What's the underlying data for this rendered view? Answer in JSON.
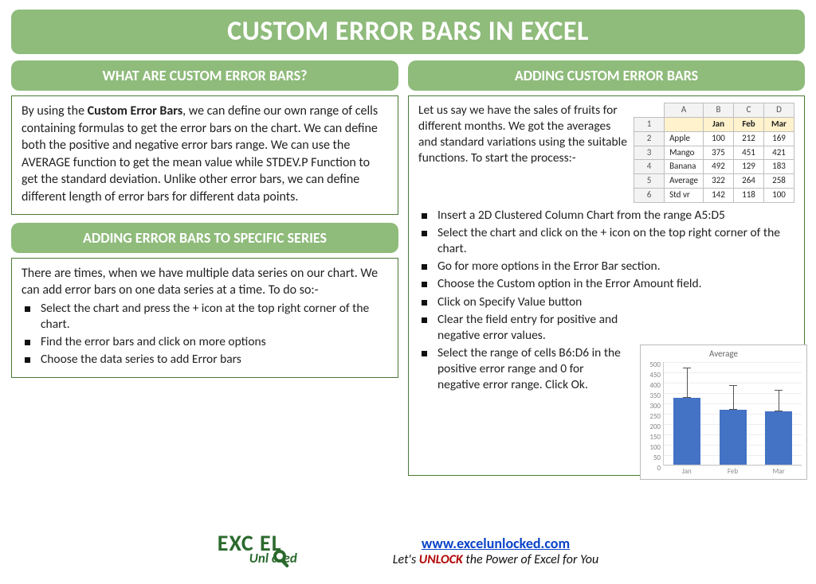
{
  "title": "CUSTOM ERROR BARS IN EXCEL",
  "left": {
    "s1_head": "WHAT ARE CUSTOM ERROR BARS?",
    "s1_body_pre": "By using the ",
    "s1_body_bold": "Custom Error Bars",
    "s1_body_post": ", we can define our own range of cells containing formulas to get the error bars on the chart. We can define both the positive and negative error bars range. We can use the AVERAGE function to get the mean value while STDEV.P Function to get the standard deviation. Unlike other error bars, we can define different length of error bars for different data points.",
    "s2_head": "ADDING ERROR BARS TO SPECIFIC SERIES",
    "s2_intro": "There are times, when we have multiple data series on our chart. We can add error bars on one data series at a time. To do so:-",
    "s2_steps": [
      "Select the chart and press the + icon at the top right corner of the chart.",
      "Find the error bars and click on more options",
      "Choose the data series to add Error bars"
    ]
  },
  "right": {
    "head": "ADDING CUSTOM ERROR BARS",
    "intro": "Let us say we have the sales of fruits for different months. We got the averages and standard variations using the suitable functions. To start the process:-",
    "table": {
      "cols": [
        "A",
        "B",
        "C",
        "D"
      ],
      "header_row": [
        "",
        "Jan",
        "Feb",
        "Mar"
      ],
      "rows": [
        [
          "Apple",
          "100",
          "212",
          "169"
        ],
        [
          "Mango",
          "375",
          "451",
          "421"
        ],
        [
          "Banana",
          "492",
          "129",
          "183"
        ],
        [
          "Average",
          "322",
          "264",
          "258"
        ],
        [
          "Std vr",
          "142",
          "118",
          "100"
        ]
      ]
    },
    "steps": [
      "Insert a 2D Clustered Column Chart from the range A5:D5",
      "Select the chart and click on the + icon on the top right corner of the chart.",
      "Go for more options in the Error Bar section.",
      "Choose the Custom option in the Error Amount field.",
      "Click on Specify Value button",
      "Clear the field entry for positive and negative error values.",
      "Select the range of cells B6:D6 in the positive error range and 0 for negative error range. Click Ok."
    ]
  },
  "chart_data": {
    "type": "bar",
    "title": "Average",
    "categories": [
      "Jan",
      "Feb",
      "Mar"
    ],
    "values": [
      322,
      264,
      258
    ],
    "error_plus": [
      142,
      118,
      100
    ],
    "error_minus": [
      0,
      0,
      0
    ],
    "ylim": [
      0,
      500
    ],
    "yticks": [
      0,
      50,
      100,
      150,
      200,
      250,
      300,
      350,
      400,
      450,
      500
    ],
    "xlabel": "",
    "ylabel": ""
  },
  "footer": {
    "url": "www.excelunlocked.com",
    "slogan_pre": "Let's ",
    "slogan_em": "UNLOCK",
    "slogan_post": " the Power of Excel for You",
    "logo_big": "EXC  EL",
    "logo_sub": "Unl   cked"
  }
}
